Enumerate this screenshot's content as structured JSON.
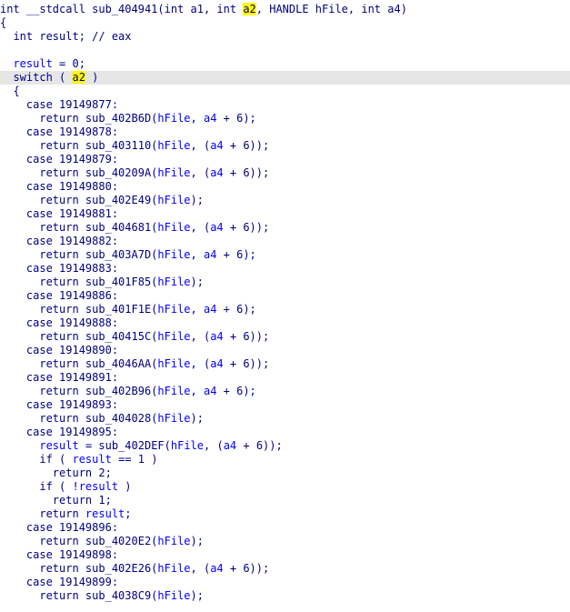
{
  "code": {
    "lines": [
      {
        "parts": [
          {
            "t": "int __stdcall sub_404941(int a1, int "
          },
          {
            "t": "a2",
            "c": "hl"
          },
          {
            "t": ", HANDLE hFile, int a4)"
          }
        ]
      },
      {
        "parts": [
          {
            "t": "{"
          }
        ]
      },
      {
        "parts": [
          {
            "t": "  int result; // eax"
          }
        ]
      },
      {
        "parts": [
          {
            "t": ""
          }
        ]
      },
      {
        "parts": [
          {
            "t": "  "
          },
          {
            "t": "result",
            "c": "var"
          },
          {
            "t": " = 0;"
          }
        ]
      },
      {
        "current": true,
        "parts": [
          {
            "t": "  switch ( "
          },
          {
            "t": "",
            "c": "caret"
          },
          {
            "t": "a2",
            "c": "hl"
          },
          {
            "t": " )"
          }
        ]
      },
      {
        "parts": [
          {
            "t": "  {"
          }
        ]
      },
      {
        "parts": [
          {
            "t": "    case 19149877:"
          }
        ]
      },
      {
        "parts": [
          {
            "t": "      return sub_402B6D("
          },
          {
            "t": "hFile",
            "c": "var"
          },
          {
            "t": ", "
          },
          {
            "t": "a4",
            "c": "var"
          },
          {
            "t": " + 6);"
          }
        ]
      },
      {
        "parts": [
          {
            "t": "    case 19149878:"
          }
        ]
      },
      {
        "parts": [
          {
            "t": "      return sub_403110("
          },
          {
            "t": "hFile",
            "c": "var"
          },
          {
            "t": ", ("
          },
          {
            "t": "a4",
            "c": "var"
          },
          {
            "t": " + 6));"
          }
        ]
      },
      {
        "parts": [
          {
            "t": "    case 19149879:"
          }
        ]
      },
      {
        "parts": [
          {
            "t": "      return sub_40209A("
          },
          {
            "t": "hFile",
            "c": "var"
          },
          {
            "t": ", ("
          },
          {
            "t": "a4",
            "c": "var"
          },
          {
            "t": " + 6));"
          }
        ]
      },
      {
        "parts": [
          {
            "t": "    case 19149880:"
          }
        ]
      },
      {
        "parts": [
          {
            "t": "      return sub_402E49("
          },
          {
            "t": "hFile",
            "c": "var"
          },
          {
            "t": ");"
          }
        ]
      },
      {
        "parts": [
          {
            "t": "    case 19149881:"
          }
        ]
      },
      {
        "parts": [
          {
            "t": "      return sub_404681("
          },
          {
            "t": "hFile",
            "c": "var"
          },
          {
            "t": ", ("
          },
          {
            "t": "a4",
            "c": "var"
          },
          {
            "t": " + 6));"
          }
        ]
      },
      {
        "parts": [
          {
            "t": "    case 19149882:"
          }
        ]
      },
      {
        "parts": [
          {
            "t": "      return sub_403A7D("
          },
          {
            "t": "hFile",
            "c": "var"
          },
          {
            "t": ", "
          },
          {
            "t": "a4",
            "c": "var"
          },
          {
            "t": " + 6);"
          }
        ]
      },
      {
        "parts": [
          {
            "t": "    case 19149883:"
          }
        ]
      },
      {
        "parts": [
          {
            "t": "      return sub_401F85("
          },
          {
            "t": "hFile",
            "c": "var"
          },
          {
            "t": ");"
          }
        ]
      },
      {
        "parts": [
          {
            "t": "    case 19149886:"
          }
        ]
      },
      {
        "parts": [
          {
            "t": "      return sub_401F1E("
          },
          {
            "t": "hFile",
            "c": "var"
          },
          {
            "t": ", "
          },
          {
            "t": "a4",
            "c": "var"
          },
          {
            "t": " + 6);"
          }
        ]
      },
      {
        "parts": [
          {
            "t": "    case 19149888:"
          }
        ]
      },
      {
        "parts": [
          {
            "t": "      return sub_40415C("
          },
          {
            "t": "hFile",
            "c": "var"
          },
          {
            "t": ", ("
          },
          {
            "t": "a4",
            "c": "var"
          },
          {
            "t": " + 6));"
          }
        ]
      },
      {
        "parts": [
          {
            "t": "    case 19149890:"
          }
        ]
      },
      {
        "parts": [
          {
            "t": "      return sub_4046AA("
          },
          {
            "t": "hFile",
            "c": "var"
          },
          {
            "t": ", ("
          },
          {
            "t": "a4",
            "c": "var"
          },
          {
            "t": " + 6));"
          }
        ]
      },
      {
        "parts": [
          {
            "t": "    case 19149891:"
          }
        ]
      },
      {
        "parts": [
          {
            "t": "      return sub_402B96("
          },
          {
            "t": "hFile",
            "c": "var"
          },
          {
            "t": ", "
          },
          {
            "t": "a4",
            "c": "var"
          },
          {
            "t": " + 6);"
          }
        ]
      },
      {
        "parts": [
          {
            "t": "    case 19149893:"
          }
        ]
      },
      {
        "parts": [
          {
            "t": "      return sub_404028("
          },
          {
            "t": "hFile",
            "c": "var"
          },
          {
            "t": ");"
          }
        ]
      },
      {
        "parts": [
          {
            "t": "    case 19149895:"
          }
        ]
      },
      {
        "parts": [
          {
            "t": "      "
          },
          {
            "t": "result",
            "c": "var"
          },
          {
            "t": " = sub_402DEF("
          },
          {
            "t": "hFile",
            "c": "var"
          },
          {
            "t": ", ("
          },
          {
            "t": "a4",
            "c": "var"
          },
          {
            "t": " + 6));"
          }
        ]
      },
      {
        "parts": [
          {
            "t": "      if ( "
          },
          {
            "t": "result",
            "c": "var"
          },
          {
            "t": " == 1 )"
          }
        ]
      },
      {
        "parts": [
          {
            "t": "        return 2;"
          }
        ]
      },
      {
        "parts": [
          {
            "t": "      if ( !"
          },
          {
            "t": "result",
            "c": "var"
          },
          {
            "t": " )"
          }
        ]
      },
      {
        "parts": [
          {
            "t": "        return 1;"
          }
        ]
      },
      {
        "parts": [
          {
            "t": "      return "
          },
          {
            "t": "result",
            "c": "var"
          },
          {
            "t": ";"
          }
        ]
      },
      {
        "parts": [
          {
            "t": "    case 19149896:"
          }
        ]
      },
      {
        "parts": [
          {
            "t": "      return sub_4020E2("
          },
          {
            "t": "hFile",
            "c": "var"
          },
          {
            "t": ");"
          }
        ]
      },
      {
        "parts": [
          {
            "t": "    case 19149898:"
          }
        ]
      },
      {
        "parts": [
          {
            "t": "      return sub_402E26("
          },
          {
            "t": "hFile",
            "c": "var"
          },
          {
            "t": ", ("
          },
          {
            "t": "a4",
            "c": "var"
          },
          {
            "t": " + 6));"
          }
        ]
      },
      {
        "parts": [
          {
            "t": "    case 19149899:"
          }
        ]
      },
      {
        "parts": [
          {
            "t": "      return sub_4038C9("
          },
          {
            "t": "hFile",
            "c": "var"
          },
          {
            "t": ");"
          }
        ]
      }
    ]
  },
  "colors": {
    "text": "#000080",
    "variable": "#0000ff",
    "highlight": "#ffff00",
    "current_line": "#e6e6e6"
  }
}
